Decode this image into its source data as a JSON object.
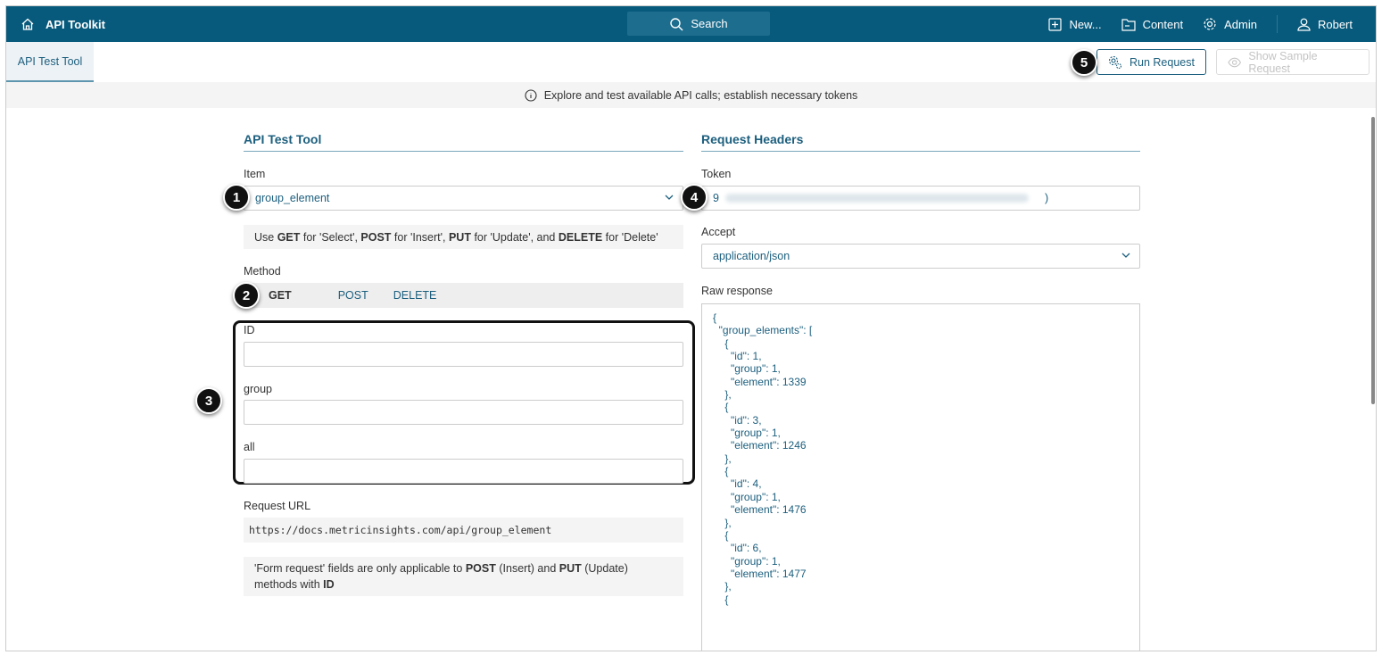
{
  "header": {
    "brand": "API Toolkit",
    "search": "Search",
    "nav": [
      "New...",
      "Content",
      "Admin",
      "Robert"
    ]
  },
  "tabs": {
    "active": "API Test Tool"
  },
  "toolbar": {
    "run": "Run Request",
    "sample": "Show Sample Request"
  },
  "info": "Explore and test available API calls; establish necessary tokens",
  "left": {
    "title": "API Test Tool",
    "item_label": "Item",
    "item_value": "group_element",
    "method_note": {
      "a": "Use ",
      "b": "GET",
      "c": " for 'Select', ",
      "d": "POST",
      "e": " for 'Insert', ",
      "f": "PUT",
      "g": " for 'Update', and ",
      "h": "DELETE",
      "i": " for 'Delete'"
    },
    "method_label": "Method",
    "methods": [
      "GET",
      "POST",
      "DELETE"
    ],
    "fields": [
      "ID",
      "group",
      "all"
    ],
    "url_label": "Request URL",
    "url": "https://docs.metricinsights.com/api/group_element",
    "form_note": {
      "a": "'Form request' fields are only applicable to ",
      "b": "POST",
      "c": " (Insert) and ",
      "d": "PUT",
      "e": " (Update) methods with ",
      "f": "ID"
    }
  },
  "right": {
    "title": "Request Headers",
    "token_label": "Token",
    "token_start": "9",
    "token_end": ")",
    "accept_label": "Accept",
    "accept_value": "application/json",
    "raw_label": "Raw response",
    "raw": "{\n  \"group_elements\": [\n    {\n      \"id\": 1,\n      \"group\": 1,\n      \"element\": 1339\n    },\n    {\n      \"id\": 3,\n      \"group\": 1,\n      \"element\": 1246\n    },\n    {\n      \"id\": 4,\n      \"group\": 1,\n      \"element\": 1476\n    },\n    {\n      \"id\": 6,\n      \"group\": 1,\n      \"element\": 1477\n    },\n    {"
  },
  "badges": [
    "1",
    "2",
    "3",
    "4",
    "5"
  ]
}
